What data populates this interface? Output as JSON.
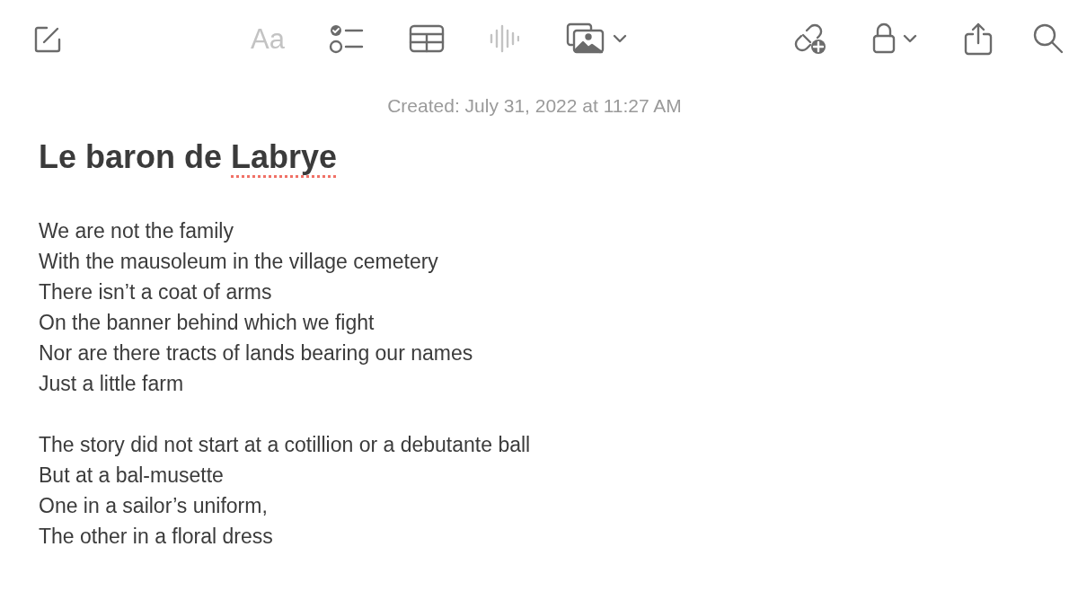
{
  "toolbar": [
    {
      "kind": "compose",
      "disabled": false
    },
    {
      "kind": "format",
      "label": "Aa",
      "disabled": true
    },
    {
      "kind": "checklist",
      "disabled": false
    },
    {
      "kind": "table",
      "disabled": false
    },
    {
      "kind": "audio",
      "disabled": true
    },
    {
      "kind": "media",
      "disabled": false
    },
    {
      "kind": "dropdown",
      "disabled": false
    },
    {
      "kind": "collaborate",
      "disabled": false
    },
    {
      "kind": "lock",
      "disabled": false
    },
    {
      "kind": "dropdown",
      "disabled": false
    },
    {
      "kind": "share",
      "disabled": false
    },
    {
      "kind": "search",
      "disabled": false
    }
  ],
  "note": {
    "created": "Created: July 31, 2022 at 11:27 AM",
    "title": [
      {
        "text": "Le baron de ",
        "misspelled": false
      },
      {
        "text": "Labrye",
        "misspelled": true
      }
    ],
    "stanzas": [
      [
        "We are not the family",
        "With the mausoleum in the village cemetery",
        "There isn’t a coat of arms",
        "On the banner behind which we fight",
        "Nor are there tracts of lands bearing our names",
        "Just a little farm"
      ],
      [
        "The story did not start at a cotillion or a debutante ball",
        "But at a bal-musette",
        "One in a sailor’s uniform,",
        "The other in a floral dress"
      ]
    ]
  }
}
